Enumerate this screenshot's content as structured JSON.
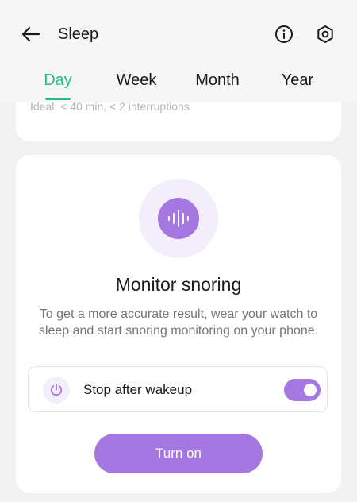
{
  "header": {
    "title": "Sleep",
    "back_icon": "arrow-left-icon",
    "info_icon": "info-icon",
    "settings_icon": "hexagon-settings-icon"
  },
  "tabs": [
    {
      "label": "Day",
      "active": true
    },
    {
      "label": "Week",
      "active": false
    },
    {
      "label": "Month",
      "active": false
    },
    {
      "label": "Year",
      "active": false
    }
  ],
  "top_card": {
    "ideal_text": "Ideal: < 40 min, < 2 interruptions"
  },
  "snoring_card": {
    "icon": "sound-wave-icon",
    "title": "Monitor snoring",
    "description": "To get a more accurate result, wear your watch to sleep and start snoring monitoring on your phone.",
    "option": {
      "icon": "power-icon",
      "label": "Stop after wakeup",
      "toggle_on": true
    },
    "button_label": "Turn on"
  },
  "colors": {
    "accent_green": "#1fbf85",
    "accent_purple": "#a577e0",
    "light_purple": "#f3eefb",
    "background": "#f2f2f2"
  }
}
